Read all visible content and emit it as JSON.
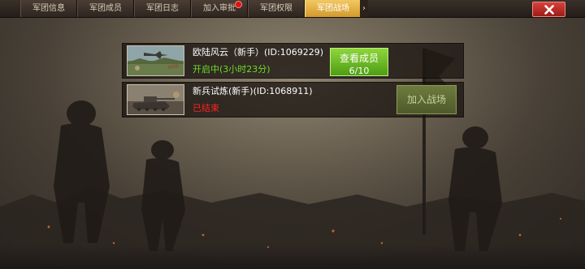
{
  "tabs": [
    {
      "label": "军团信息",
      "active": false,
      "has_alert": false
    },
    {
      "label": "军团成员",
      "active": false,
      "has_alert": false
    },
    {
      "label": "军团日志",
      "active": false,
      "has_alert": false
    },
    {
      "label": "加入审批",
      "active": false,
      "has_alert": true
    },
    {
      "label": "军团权限",
      "active": false,
      "has_alert": false
    },
    {
      "label": "军团战场",
      "active": true,
      "has_alert": false
    }
  ],
  "tab_scroll_icon": "chevron-right-icon",
  "close_icon": "close-icon",
  "battles": [
    {
      "title": "欧陆风云（新手）(ID:1069229)",
      "status": "开启中(3小时23分)",
      "status_kind": "open",
      "button_line1": "查看成员",
      "button_line2": "6/10",
      "thumbnail": "aircraft-battle-thumbnail"
    },
    {
      "title": "新兵试炼(新手)(ID:1068911)",
      "status": "已结束",
      "status_kind": "ended",
      "button_label": "加入战场",
      "thumbnail": "tank-battle-thumbnail"
    }
  ],
  "colors": {
    "active_tab": "#e6b449",
    "open_status": "#6edc28",
    "ended_status": "#ff2020",
    "members_button": "#6fbf24",
    "join_button_disabled": "#5e6b34",
    "close_button": "#c0302a"
  }
}
